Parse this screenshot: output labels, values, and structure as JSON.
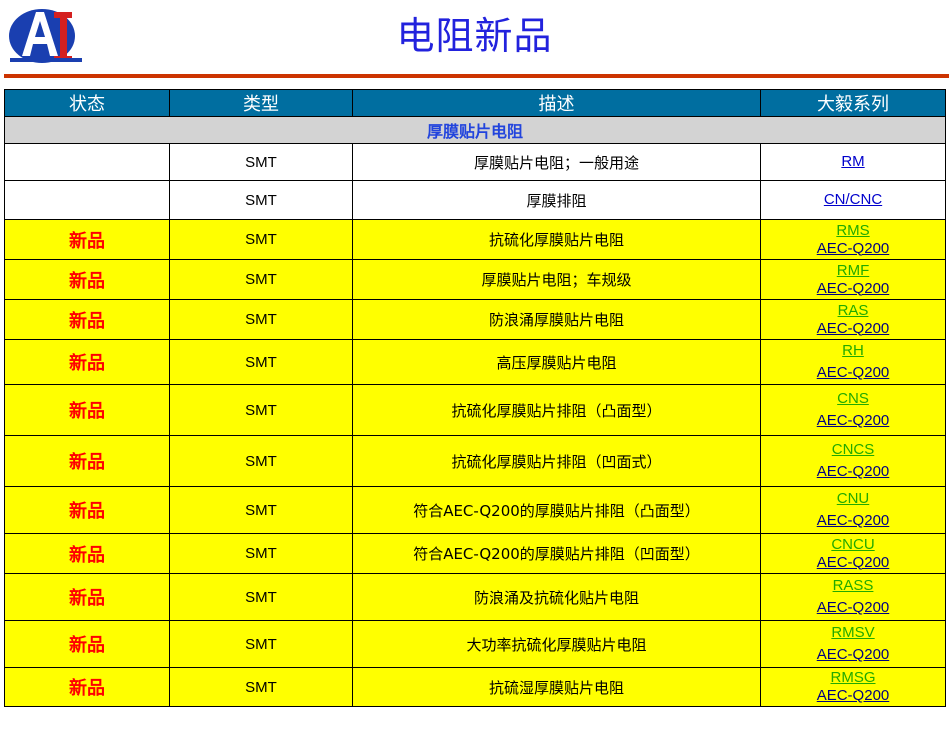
{
  "page": {
    "title": "电阻新品",
    "logo_text": "AI"
  },
  "table": {
    "headers": [
      "状态",
      "类型",
      "描述",
      "大毅系列"
    ],
    "category": "厚膜贴片电阻",
    "rows": [
      {
        "status": "",
        "type": "SMT",
        "desc": "厚膜贴片电阻；一般用途",
        "series": "RM",
        "spec": ""
      },
      {
        "status": "",
        "type": "SMT",
        "desc": "厚膜排阻",
        "series": "CN/CNC",
        "spec": ""
      },
      {
        "status": "新品",
        "type": "SMT",
        "desc": "抗硫化厚膜贴片电阻",
        "series": "RMS",
        "spec": "AEC-Q200"
      },
      {
        "status": "新品",
        "type": "SMT",
        "desc": "厚膜贴片电阻；车规级",
        "series": "RMF",
        "spec": "AEC-Q200"
      },
      {
        "status": "新品",
        "type": "SMT",
        "desc": "防浪涌厚膜贴片电阻",
        "series": "RAS",
        "spec": "AEC-Q200"
      },
      {
        "status": "新品",
        "type": "SMT",
        "desc": "高压厚膜贴片电阻",
        "series": "RH",
        "spec": "AEC-Q200"
      },
      {
        "status": "新品",
        "type": "SMT",
        "desc": "抗硫化厚膜贴片排阻（凸面型）",
        "series": "CNS",
        "spec": "AEC-Q200"
      },
      {
        "status": "新品",
        "type": "SMT",
        "desc": "抗硫化厚膜贴片排阻（凹面式）",
        "series": "CNCS",
        "spec": "AEC-Q200"
      },
      {
        "status": "新品",
        "type": "SMT",
        "desc": "符合AEC-Q200的厚膜贴片排阻（凸面型）",
        "series": "CNU",
        "spec": "AEC-Q200"
      },
      {
        "status": "新品",
        "type": "SMT",
        "desc": "符合AEC-Q200的厚膜贴片排阻（凹面型）",
        "series": "CNCU",
        "spec": "AEC-Q200"
      },
      {
        "status": "新品",
        "type": "SMT",
        "desc": "防浪涌及抗硫化贴片电阻",
        "series": "RASS",
        "spec": "AEC-Q200"
      },
      {
        "status": "新品",
        "type": "SMT",
        "desc": "大功率抗硫化厚膜贴片电阻",
        "series": "RMSV",
        "spec": "AEC-Q200"
      },
      {
        "status": "新品",
        "type": "SMT",
        "desc": "抗硫湿厚膜贴片电阻",
        "series": "RMSG",
        "spec": "AEC-Q200"
      }
    ]
  },
  "colors": {
    "title": "#2222dd",
    "header_bg": "#006ea0",
    "category_bg": "#d3d3d3",
    "highlight_bg": "#ffff00",
    "status_red": "#ff0000",
    "rule": "#cc3300"
  }
}
